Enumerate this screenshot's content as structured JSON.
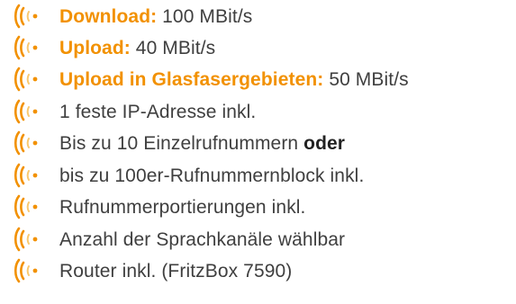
{
  "features": [
    {
      "label": "Download:",
      "value": "100 MBit/s"
    },
    {
      "label": "Upload:",
      "value": "40 MBit/s"
    },
    {
      "label": "Upload in Glasfasergebieten:",
      "value": "50 MBit/s"
    },
    {
      "text": "1 feste IP-Adresse inkl."
    },
    {
      "text_before": "Bis zu 10 Einzelrufnummern",
      "text_bold": "oder"
    },
    {
      "text": "bis zu 100er-Rufnummernblock inkl."
    },
    {
      "text": "Rufnummerportierungen inkl."
    },
    {
      "text": "Anzahl der Sprachkanäle wählbar"
    },
    {
      "text": "Router inkl. (FritzBox 7590)"
    }
  ],
  "icon": "signal-wave-icon",
  "colors": {
    "accent": "#f29100",
    "text": "#3f3f3f"
  }
}
